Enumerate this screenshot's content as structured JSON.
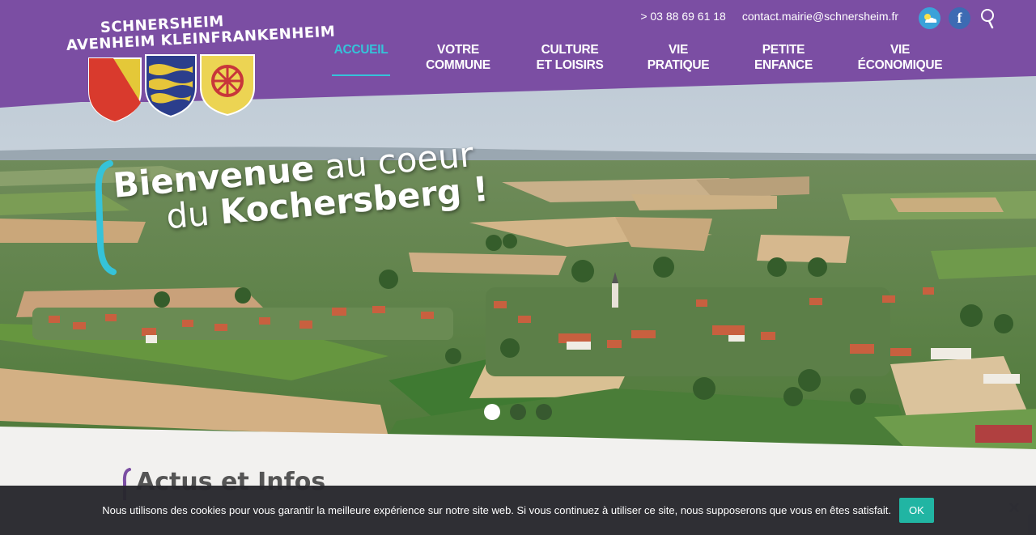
{
  "header": {
    "logo": {
      "line1": "SCHNERSHEIM",
      "line2": "AVENHEIM KLEINFRANKENHEIM"
    },
    "phone": "> 03 88 69 61 18",
    "email": "contact.mairie@schnersheim.fr",
    "icons": [
      "weather-icon",
      "facebook-icon",
      "search-icon"
    ],
    "facebook_glyph": "f"
  },
  "nav": {
    "items": [
      {
        "label": "ACCUEIL",
        "active": true
      },
      {
        "label": "VOTRE\nCOMMUNE"
      },
      {
        "label": "CULTURE\nET LOISIRS"
      },
      {
        "label": "VIE\nPRATIQUE"
      },
      {
        "label": "PETITE\nENFANCE"
      },
      {
        "label": "VIE\nÉCONOMIQUE"
      }
    ]
  },
  "hero": {
    "welcome_bold1": "Bienvenue",
    "welcome_rest1": " au coeur",
    "welcome_rest2": "du ",
    "welcome_bold2": "Kochersberg !",
    "slides": 3,
    "active_slide": 1
  },
  "section": {
    "title": "Actus et Infos"
  },
  "cookie": {
    "message": "Nous utilisons des cookies pour vous garantir la meilleure expérience sur notre site web. Si vous continuez à utiliser ce site, nous supposerons que vous en êtes satisfait.",
    "ok_label": "OK"
  },
  "colors": {
    "brand_purple": "#7b4ea3",
    "accent_cyan": "#35c3d9",
    "cookie_bg": "#26262c",
    "ok_button": "#21b5a3"
  }
}
